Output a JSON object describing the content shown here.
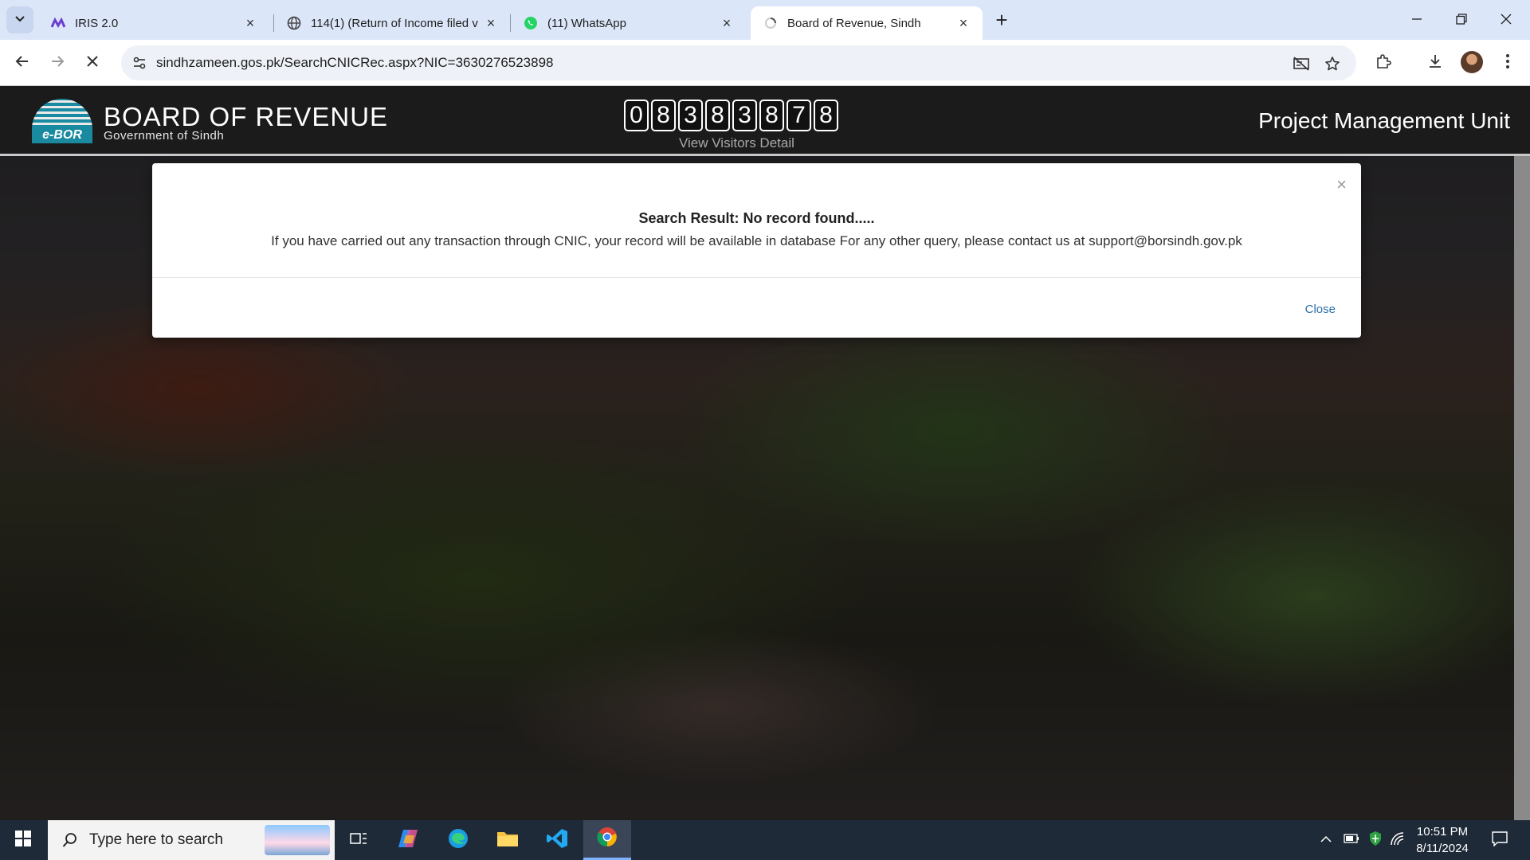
{
  "browser": {
    "tabs": [
      {
        "title": "IRIS 2.0",
        "icon": "iris-icon"
      },
      {
        "title": "114(1) (Return of Income filed v",
        "icon": "globe-icon"
      },
      {
        "title": "(11) WhatsApp",
        "icon": "whatsapp-icon"
      },
      {
        "title": "Board of Revenue, Sindh",
        "icon": "loading-icon"
      }
    ],
    "url": "sindhzameen.gos.pk/SearchCNICRec.aspx?NIC=3630276523898"
  },
  "site": {
    "logo_badge": "e-BOR",
    "title": "BOARD OF REVENUE",
    "subtitle": "Government of Sindh",
    "visitor_digits": [
      "0",
      "8",
      "3",
      "8",
      "3",
      "8",
      "7",
      "8"
    ],
    "visitors_link": "View Visitors Detail",
    "unit_name": "Project Management Unit"
  },
  "modal": {
    "close_x": "×",
    "heading": "Search Result: No record found.....",
    "message": "If you have carried out any transaction through CNIC, your record will be available in database For any other query, please contact us at support@borsindh.gov.pk",
    "close_button": "Close"
  },
  "taskbar": {
    "search_placeholder": "Type here to search",
    "time": "10:51 PM",
    "date": "8/11/2024"
  },
  "colors": {
    "header_bg": "#1b1b1b",
    "link_blue": "#2a6fa8",
    "tabstrip_bg": "#dbe6f9",
    "taskbar_bg": "#1e2a38"
  }
}
